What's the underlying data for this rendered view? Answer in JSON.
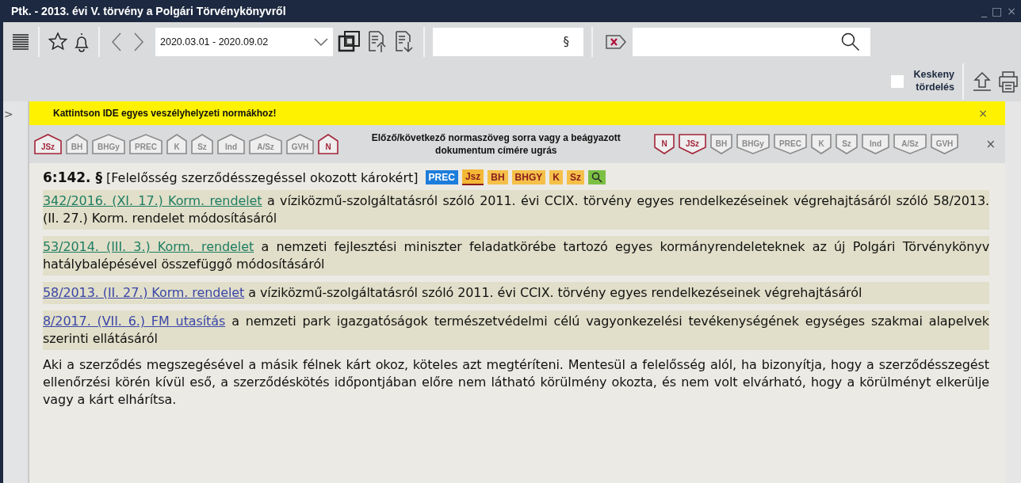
{
  "window": {
    "title": "Ptk. - 2013. évi V. törvény a Polgári Törvénykönyvről",
    "controls": [
      "_",
      "□",
      "×"
    ]
  },
  "toolbar": {
    "date_range": "2020.03.01 - 2020.09.02",
    "paragraph_button": "§",
    "narrow_layout": {
      "label": "Keskeny tördelés",
      "checked": false
    }
  },
  "sidebar_toggle": ">",
  "banner": {
    "text": "Kattintson IDE egyes veszélyhelyzeti normákhoz!",
    "close": "×"
  },
  "navigation": {
    "hint": "Előző/következő normaszöveg sorra vagy a beágyazott dokumentum címére ugrás",
    "close": "×",
    "previous": [
      {
        "label": "JSz",
        "active": true
      },
      {
        "label": "BH",
        "active": false
      },
      {
        "label": "BHGy",
        "active": false
      },
      {
        "label": "PREC",
        "active": false
      },
      {
        "label": "K",
        "active": false
      },
      {
        "label": "Sz",
        "active": false
      },
      {
        "label": "Ind",
        "active": false
      },
      {
        "label": "A/Sz",
        "active": false
      },
      {
        "label": "GVH",
        "active": false
      },
      {
        "label": "N",
        "active": true
      }
    ],
    "next": [
      {
        "label": "N",
        "active": true
      },
      {
        "label": "JSz",
        "active": true
      },
      {
        "label": "BH",
        "active": false
      },
      {
        "label": "BHGy",
        "active": false
      },
      {
        "label": "PREC",
        "active": false
      },
      {
        "label": "K",
        "active": false
      },
      {
        "label": "Sz",
        "active": false
      },
      {
        "label": "Ind",
        "active": false
      },
      {
        "label": "A/Sz",
        "active": false
      },
      {
        "label": "GVH",
        "active": false
      }
    ]
  },
  "section": {
    "number": "6:142. §",
    "title": "[Felelősség szerződésszegéssel okozott károkért]",
    "tags": [
      {
        "kind": "prec",
        "label": "PREC"
      },
      {
        "kind": "jsz",
        "label": "Jsz"
      },
      {
        "kind": "ref",
        "label": "BH"
      },
      {
        "kind": "ref",
        "label": "BHGY"
      },
      {
        "kind": "ref",
        "label": "K"
      },
      {
        "kind": "ref",
        "label": "Sz"
      },
      {
        "kind": "search"
      }
    ],
    "references": [
      {
        "link": "342/2016. (XI. 17.) Korm. rendelet",
        "visited": true,
        "text": " a víziközmű-szolgáltatásról szóló 2011. évi CCIX. törvény egyes rendelkezéseinek végrehajtásáról szóló 58/2013. (II. 27.) Korm. rendelet módosításáról"
      },
      {
        "link": "53/2014. (III. 3.) Korm. rendelet",
        "visited": true,
        "text": " a nemzeti fejlesztési miniszter feladatkörébe tartozó egyes kormányrendeleteknek az új Polgári Törvénykönyv hatálybalépésével összefüggő módosításáról"
      },
      {
        "link": "58/2013. (II. 27.) Korm. rendelet",
        "visited": false,
        "text": " a víziközmű-szolgáltatásról szóló 2011. évi CCIX. törvény egyes rendelkezéseinek végrehajtásáról"
      },
      {
        "link": "8/2017. (VII. 6.) FM utasítás",
        "visited": false,
        "text": " a nemzeti park igazgatóságok természetvédelmi célú vagyonkezelési tevékenységének egységes szakmai alapelvek szerinti ellátásáról"
      }
    ],
    "body": "Aki a szerződés megszegésével a másik félnek kárt okoz, köteles azt megtéríteni. Mentesül a felelősség alól, ha bizonyítja, hogy a szerződésszegést ellenőrzési körén kívül eső, a szerződéskötés időpontjában előre nem látható körülmény okozta, és nem volt elvárható, hogy a körülményt elkerülje vagy a kárt elhárítsa."
  }
}
